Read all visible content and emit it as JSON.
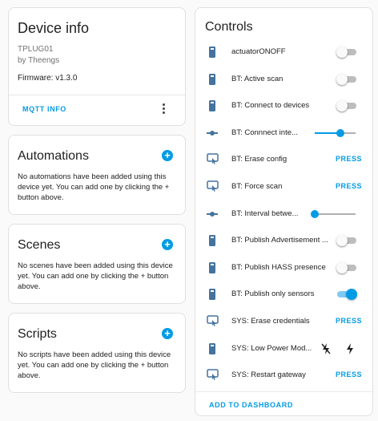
{
  "device": {
    "title": "Device info",
    "model": "TPLUG01",
    "manufacturer": "by Theengs",
    "firmware": "Firmware: v1.3.0",
    "mqtt_button": "MQTT INFO"
  },
  "automations": {
    "title": "Automations",
    "empty_text": "No automations have been added using this device yet. You can add one by clicking the + button above."
  },
  "scenes": {
    "title": "Scenes",
    "empty_text": "No scenes have been added using this device yet. You can add one by clicking the + button above."
  },
  "scripts": {
    "title": "Scripts",
    "empty_text": "No scripts have been added using this device yet. You can add one by clicking the + button above."
  },
  "controls": {
    "title": "Controls",
    "dashboard_button": "ADD TO DASHBOARD",
    "items": [
      {
        "label": "actuatorONOFF",
        "kind": "toggle",
        "on": false,
        "icon": "device-icon"
      },
      {
        "label": "BT: Active scan",
        "kind": "toggle",
        "on": false,
        "icon": "device-icon"
      },
      {
        "label": "BT: Connect to devices",
        "kind": "toggle",
        "on": false,
        "icon": "device-icon"
      },
      {
        "label": "BT: Connnect inte...",
        "kind": "slider",
        "level": 0.62,
        "icon": "slider-icon"
      },
      {
        "label": "BT: Erase config",
        "kind": "button",
        "action": "PRESS",
        "icon": "gesture-tap-icon"
      },
      {
        "label": "BT: Force scan",
        "kind": "button",
        "action": "PRESS",
        "icon": "gesture-tap-icon"
      },
      {
        "label": "BT: Interval betwe...",
        "kind": "slider",
        "level": 0.0,
        "icon": "slider-icon"
      },
      {
        "label": "BT: Publish Advertisement ...",
        "kind": "toggle",
        "on": false,
        "icon": "device-icon"
      },
      {
        "label": "BT: Publish HASS presence",
        "kind": "toggle",
        "on": false,
        "icon": "device-icon"
      },
      {
        "label": "BT: Publish only sensors",
        "kind": "toggle",
        "on": true,
        "icon": "device-icon"
      },
      {
        "label": "SYS: Erase credentials",
        "kind": "button",
        "action": "PRESS",
        "icon": "gesture-tap-icon"
      },
      {
        "label": "SYS: Low Power Mod...",
        "kind": "flash",
        "icon": "device-icon"
      },
      {
        "label": "SYS: Restart gateway",
        "kind": "button",
        "action": "PRESS",
        "icon": "gesture-tap-icon"
      }
    ]
  },
  "colors": {
    "accent": "#039be5",
    "icon": "#44739e"
  }
}
